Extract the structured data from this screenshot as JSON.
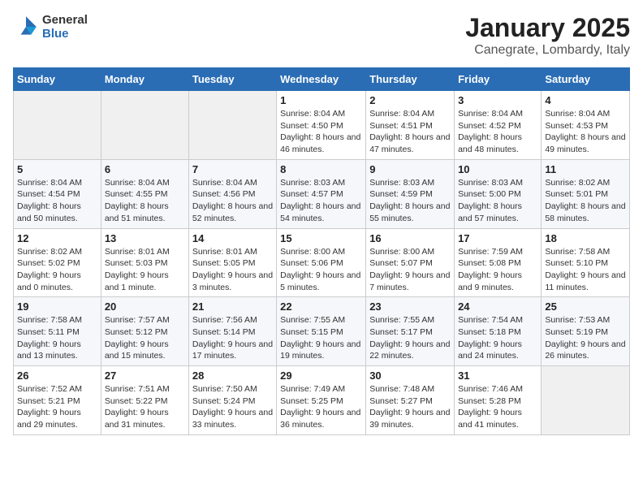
{
  "header": {
    "logo_general": "General",
    "logo_blue": "Blue",
    "month": "January 2025",
    "location": "Canegrate, Lombardy, Italy"
  },
  "weekdays": [
    "Sunday",
    "Monday",
    "Tuesday",
    "Wednesday",
    "Thursday",
    "Friday",
    "Saturday"
  ],
  "weeks": [
    [
      {
        "day": "",
        "info": ""
      },
      {
        "day": "",
        "info": ""
      },
      {
        "day": "",
        "info": ""
      },
      {
        "day": "1",
        "info": "Sunrise: 8:04 AM\nSunset: 4:50 PM\nDaylight: 8 hours and 46 minutes."
      },
      {
        "day": "2",
        "info": "Sunrise: 8:04 AM\nSunset: 4:51 PM\nDaylight: 8 hours and 47 minutes."
      },
      {
        "day": "3",
        "info": "Sunrise: 8:04 AM\nSunset: 4:52 PM\nDaylight: 8 hours and 48 minutes."
      },
      {
        "day": "4",
        "info": "Sunrise: 8:04 AM\nSunset: 4:53 PM\nDaylight: 8 hours and 49 minutes."
      }
    ],
    [
      {
        "day": "5",
        "info": "Sunrise: 8:04 AM\nSunset: 4:54 PM\nDaylight: 8 hours and 50 minutes."
      },
      {
        "day": "6",
        "info": "Sunrise: 8:04 AM\nSunset: 4:55 PM\nDaylight: 8 hours and 51 minutes."
      },
      {
        "day": "7",
        "info": "Sunrise: 8:04 AM\nSunset: 4:56 PM\nDaylight: 8 hours and 52 minutes."
      },
      {
        "day": "8",
        "info": "Sunrise: 8:03 AM\nSunset: 4:57 PM\nDaylight: 8 hours and 54 minutes."
      },
      {
        "day": "9",
        "info": "Sunrise: 8:03 AM\nSunset: 4:59 PM\nDaylight: 8 hours and 55 minutes."
      },
      {
        "day": "10",
        "info": "Sunrise: 8:03 AM\nSunset: 5:00 PM\nDaylight: 8 hours and 57 minutes."
      },
      {
        "day": "11",
        "info": "Sunrise: 8:02 AM\nSunset: 5:01 PM\nDaylight: 8 hours and 58 minutes."
      }
    ],
    [
      {
        "day": "12",
        "info": "Sunrise: 8:02 AM\nSunset: 5:02 PM\nDaylight: 9 hours and 0 minutes."
      },
      {
        "day": "13",
        "info": "Sunrise: 8:01 AM\nSunset: 5:03 PM\nDaylight: 9 hours and 1 minute."
      },
      {
        "day": "14",
        "info": "Sunrise: 8:01 AM\nSunset: 5:05 PM\nDaylight: 9 hours and 3 minutes."
      },
      {
        "day": "15",
        "info": "Sunrise: 8:00 AM\nSunset: 5:06 PM\nDaylight: 9 hours and 5 minutes."
      },
      {
        "day": "16",
        "info": "Sunrise: 8:00 AM\nSunset: 5:07 PM\nDaylight: 9 hours and 7 minutes."
      },
      {
        "day": "17",
        "info": "Sunrise: 7:59 AM\nSunset: 5:08 PM\nDaylight: 9 hours and 9 minutes."
      },
      {
        "day": "18",
        "info": "Sunrise: 7:58 AM\nSunset: 5:10 PM\nDaylight: 9 hours and 11 minutes."
      }
    ],
    [
      {
        "day": "19",
        "info": "Sunrise: 7:58 AM\nSunset: 5:11 PM\nDaylight: 9 hours and 13 minutes."
      },
      {
        "day": "20",
        "info": "Sunrise: 7:57 AM\nSunset: 5:12 PM\nDaylight: 9 hours and 15 minutes."
      },
      {
        "day": "21",
        "info": "Sunrise: 7:56 AM\nSunset: 5:14 PM\nDaylight: 9 hours and 17 minutes."
      },
      {
        "day": "22",
        "info": "Sunrise: 7:55 AM\nSunset: 5:15 PM\nDaylight: 9 hours and 19 minutes."
      },
      {
        "day": "23",
        "info": "Sunrise: 7:55 AM\nSunset: 5:17 PM\nDaylight: 9 hours and 22 minutes."
      },
      {
        "day": "24",
        "info": "Sunrise: 7:54 AM\nSunset: 5:18 PM\nDaylight: 9 hours and 24 minutes."
      },
      {
        "day": "25",
        "info": "Sunrise: 7:53 AM\nSunset: 5:19 PM\nDaylight: 9 hours and 26 minutes."
      }
    ],
    [
      {
        "day": "26",
        "info": "Sunrise: 7:52 AM\nSunset: 5:21 PM\nDaylight: 9 hours and 29 minutes."
      },
      {
        "day": "27",
        "info": "Sunrise: 7:51 AM\nSunset: 5:22 PM\nDaylight: 9 hours and 31 minutes."
      },
      {
        "day": "28",
        "info": "Sunrise: 7:50 AM\nSunset: 5:24 PM\nDaylight: 9 hours and 33 minutes."
      },
      {
        "day": "29",
        "info": "Sunrise: 7:49 AM\nSunset: 5:25 PM\nDaylight: 9 hours and 36 minutes."
      },
      {
        "day": "30",
        "info": "Sunrise: 7:48 AM\nSunset: 5:27 PM\nDaylight: 9 hours and 39 minutes."
      },
      {
        "day": "31",
        "info": "Sunrise: 7:46 AM\nSunset: 5:28 PM\nDaylight: 9 hours and 41 minutes."
      },
      {
        "day": "",
        "info": ""
      }
    ]
  ]
}
